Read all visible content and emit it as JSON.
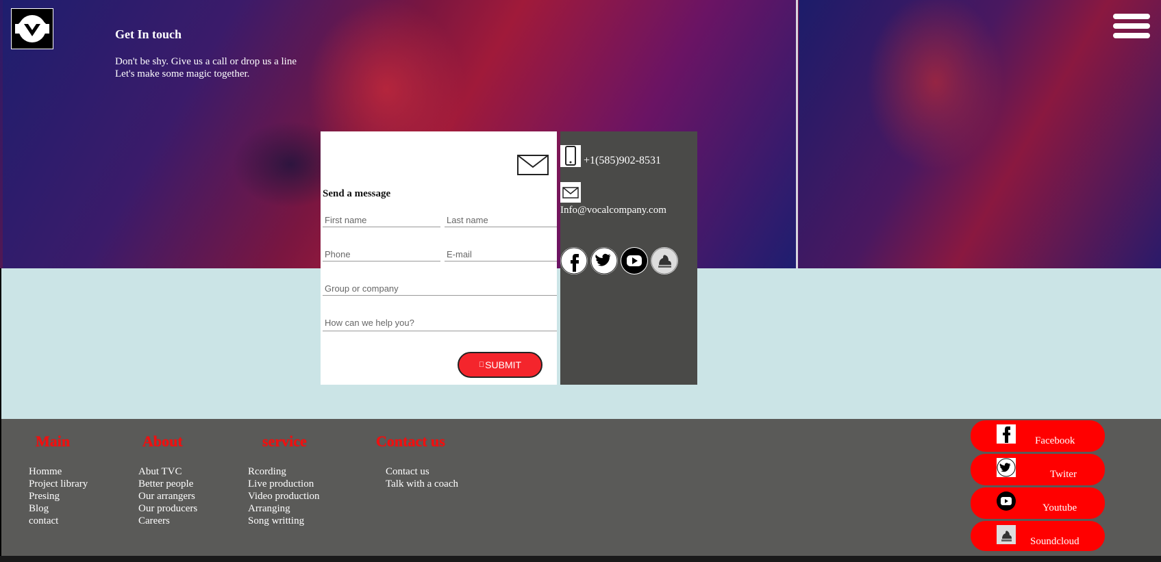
{
  "header": {
    "title": "Get In touch",
    "subtitle_line1": "Don't be shy. Give us a call or drop us a line",
    "subtitle_line2": "Let's make some magic together."
  },
  "form": {
    "heading": "Send a message",
    "first_name_placeholder": "First name",
    "last_name_placeholder": "Last name",
    "phone_placeholder": "Phone",
    "email_placeholder": "E-mail",
    "company_placeholder": "Group or company",
    "message_placeholder": "How can we help you?",
    "submit_label": "SUBMIT",
    "submit_icon": ""
  },
  "contact": {
    "phone": "+1(585)902-8531",
    "email": "Info@vocalcompany.com"
  },
  "footer": {
    "columns": [
      {
        "heading": "Main",
        "items": [
          "Homme",
          "Project library",
          "Presing",
          "Blog",
          "contact"
        ]
      },
      {
        "heading": "About",
        "items": [
          "Abut TVC",
          "Better people",
          "Our arrangers",
          "Our producers",
          "Careers"
        ]
      },
      {
        "heading": "service",
        "items": [
          "Rcording",
          "Live production",
          "Video production",
          "Arranging",
          "Song writting"
        ]
      },
      {
        "heading": "Contact us",
        "items": [
          "Contact us",
          "Talk with a coach"
        ]
      }
    ],
    "social_buttons": [
      "Facebook",
      "Twiter",
      "Youtube",
      "Soundcloud"
    ]
  },
  "colors": {
    "accent_red": "#ff0000",
    "submit_red": "#f4252c",
    "footer_bg": "#5a5a58",
    "main_bg": "#cbe4e6",
    "info_bg": "#4a4a48"
  }
}
